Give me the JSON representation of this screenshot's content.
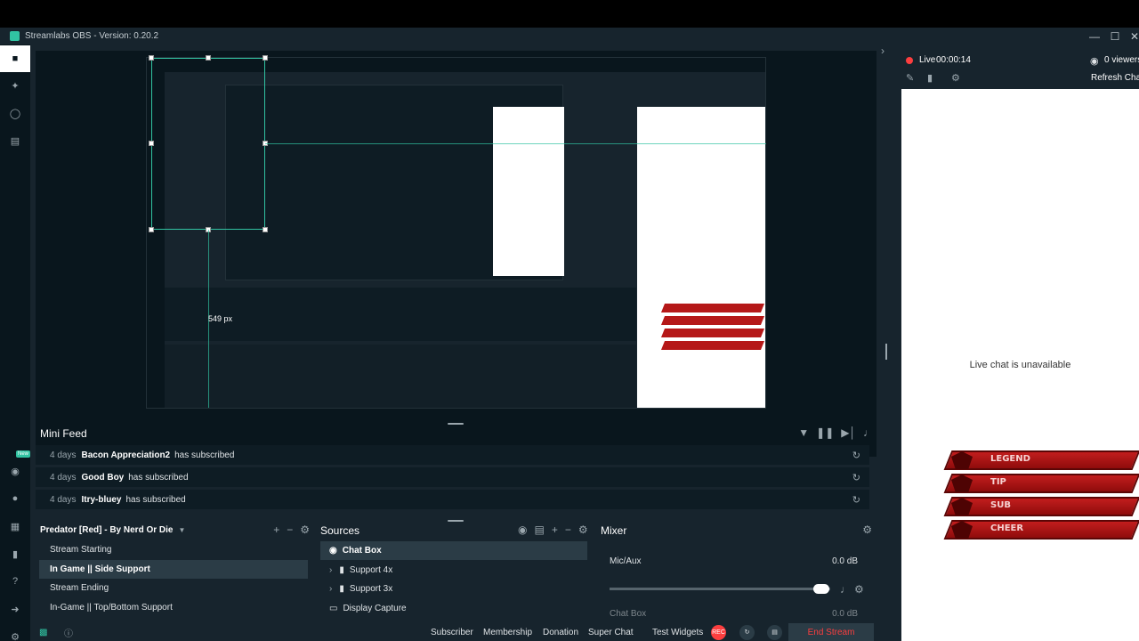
{
  "window": {
    "title": "Streamlabs OBS - Version: 0.20.2"
  },
  "stream": {
    "live_label": "Live",
    "live_timer": "00:00:14",
    "viewers": "0 viewers",
    "refresh_chat": "Refresh Chat",
    "chat_unavailable": "Live chat is unavailable"
  },
  "widgets": [
    {
      "label": "LEGEND"
    },
    {
      "label": "TIP"
    },
    {
      "label": "SUB"
    },
    {
      "label": "CHEER"
    }
  ],
  "mini_feed": {
    "title": "Mini Feed",
    "rows": [
      {
        "ago": "4 days",
        "who": "Bacon Appreciation2",
        "action": "has subscribed"
      },
      {
        "ago": "4 days",
        "who": "Good Boy",
        "action": "has subscribed"
      },
      {
        "ago": "4 days",
        "who": "Itry-bluey",
        "action": "has subscribed"
      }
    ]
  },
  "scenes": {
    "collection": "Predator [Red] - By Nerd Or Die",
    "items": [
      {
        "label": "Stream Starting"
      },
      {
        "label": "In Game || Side Support"
      },
      {
        "label": "Stream Ending"
      },
      {
        "label": "In-Game || Top/Bottom Support"
      }
    ]
  },
  "sources": {
    "title": "Sources",
    "items": [
      {
        "label": "Chat Box"
      },
      {
        "label": "Support 4x"
      },
      {
        "label": "Support 3x"
      },
      {
        "label": "Display Capture"
      }
    ]
  },
  "mixer": {
    "title": "Mixer",
    "channels": [
      {
        "name": "Mic/Aux",
        "level": "0.0 dB"
      },
      {
        "name": "Chat Box",
        "level": "0.0 dB"
      }
    ]
  },
  "footer": {
    "subscriber": "Subscriber",
    "membership": "Membership",
    "donation": "Donation",
    "super_chat": "Super Chat",
    "test_widgets": "Test Widgets",
    "rec": "REC",
    "end_stream": "End Stream"
  },
  "preview": {
    "size_readout": "549 px"
  },
  "colors": {
    "accent": "#31c3a2",
    "live_red": "#fc3e3f",
    "panel_bg": "#17242d",
    "nav_bg": "#09161d"
  }
}
